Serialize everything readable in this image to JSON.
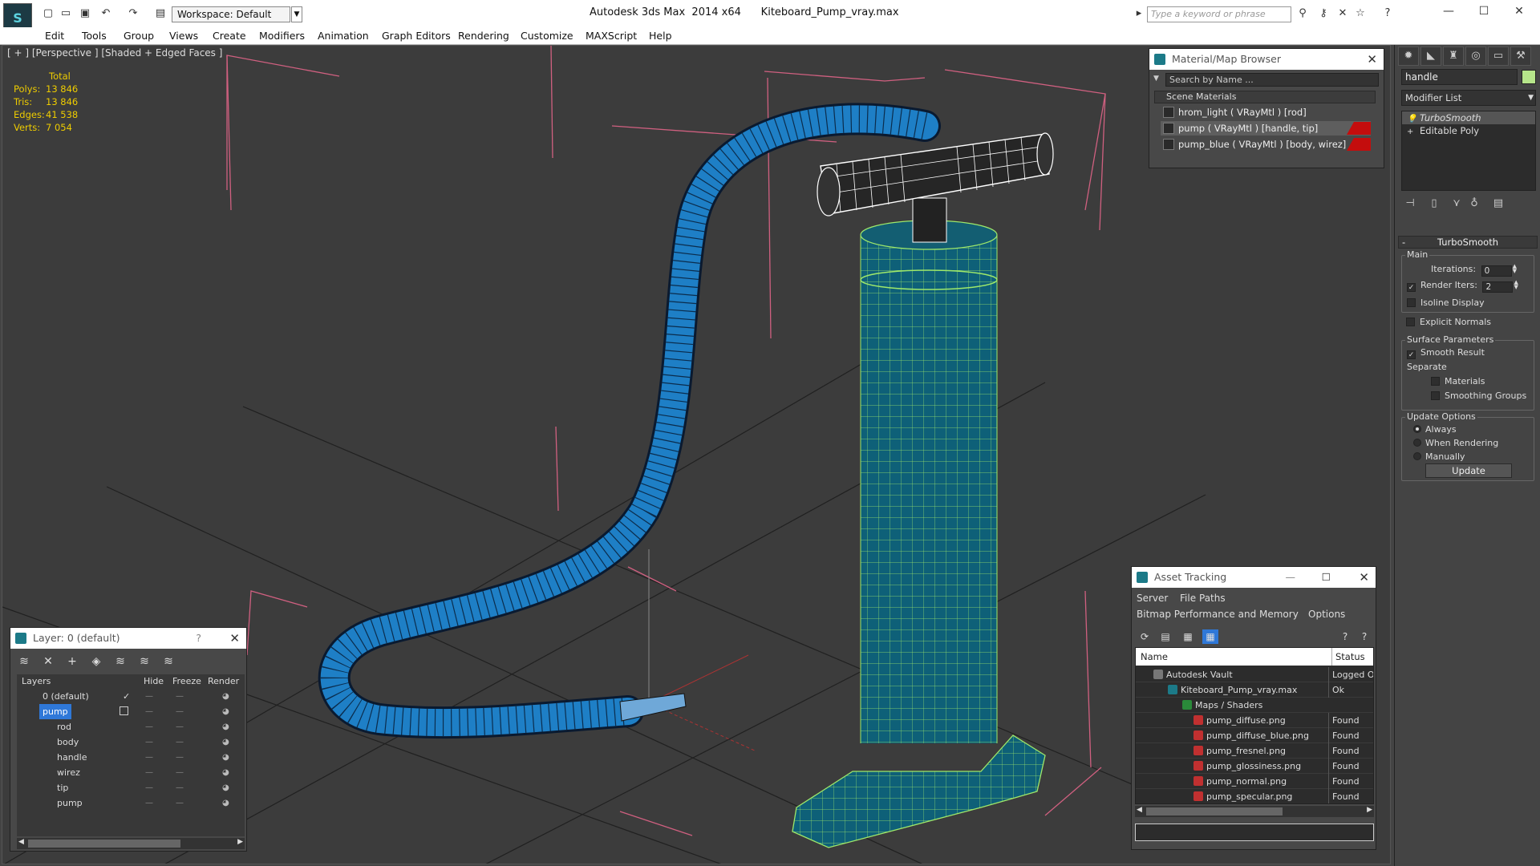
{
  "titlebar": {
    "workspace": "Workspace: Default",
    "app_title": "Autodesk 3ds Max  2014 x64      Kiteboard_Pump_vray.max",
    "search_placeholder": "Type a keyword or phrase"
  },
  "menu": [
    "Edit",
    "Tools",
    "Group",
    "Views",
    "Create",
    "Modifiers",
    "Animation",
    "Graph Editors",
    "Rendering",
    "Customize",
    "MAXScript",
    "Help"
  ],
  "viewport": {
    "label": "[ + ] [Perspective ] [Shaded + Edged Faces ]",
    "stats": {
      "header": "Total",
      "polys_label": "Polys:",
      "polys": "13 846",
      "tris_label": "Tris:",
      "tris": "13 846",
      "edges_label": "Edges:",
      "edges": "41 538",
      "verts_label": "Verts:",
      "verts": "7 054"
    }
  },
  "command_panel": {
    "object_name": "handle",
    "object_color": "#b6e58a",
    "modifier_list": "Modifier List",
    "stack": [
      "TurboSmooth",
      "Editable Poly"
    ],
    "rollout_title": "TurboSmooth",
    "main_group": "Main",
    "iterations_label": "Iterations:",
    "iterations": "0",
    "render_iters_label": "Render Iters:",
    "render_iters": "2",
    "isoline": "Isoline Display",
    "explicit_normals": "Explicit Normals",
    "surface_group": "Surface Parameters",
    "smooth_result": "Smooth Result",
    "separate": "Separate",
    "materials": "Materials",
    "smoothing_groups": "Smoothing Groups",
    "update_group": "Update Options",
    "always": "Always",
    "when_rendering": "When Rendering",
    "manually": "Manually",
    "update_button": "Update"
  },
  "material_browser": {
    "title": "Material/Map Browser",
    "search_placeholder": "Search by Name ...",
    "group": "Scene Materials",
    "materials": [
      "hrom_light  ( VRayMtl ) [rod]",
      "pump  ( VRayMtl ) [handle, tip]",
      "pump_blue  ( VRayMtl ) [body, wirez]"
    ]
  },
  "layer_dialog": {
    "title": "Layer: 0 (default)",
    "help": "?",
    "columns": [
      "Layers",
      "Hide",
      "Freeze",
      "Render"
    ],
    "rows": [
      {
        "name": "0 (default)",
        "indent": 1
      },
      {
        "name": "pump",
        "indent": 1
      },
      {
        "name": "rod",
        "indent": 2
      },
      {
        "name": "body",
        "indent": 2
      },
      {
        "name": "handle",
        "indent": 2
      },
      {
        "name": "wirez",
        "indent": 2
      },
      {
        "name": "tip",
        "indent": 2
      },
      {
        "name": "pump",
        "indent": 2
      }
    ]
  },
  "asset_tracking": {
    "title": "Asset Tracking",
    "menu1": [
      "Server",
      "File",
      "Paths"
    ],
    "menu2": [
      "Bitmap Performance and Memory",
      "Options"
    ],
    "columns": [
      "Name",
      "Status"
    ],
    "rows": [
      {
        "name": "Autodesk Vault",
        "status": "Logged Ou",
        "indent": 1
      },
      {
        "name": "Kiteboard_Pump_vray.max",
        "status": "Ok",
        "indent": 2
      },
      {
        "name": "Maps / Shaders",
        "status": "",
        "indent": 3
      },
      {
        "name": "pump_diffuse.png",
        "status": "Found",
        "indent": 4
      },
      {
        "name": "pump_diffuse_blue.png",
        "status": "Found",
        "indent": 4
      },
      {
        "name": "pump_fresnel.png",
        "status": "Found",
        "indent": 4
      },
      {
        "name": "pump_glossiness.png",
        "status": "Found",
        "indent": 4
      },
      {
        "name": "pump_normal.png",
        "status": "Found",
        "indent": 4
      },
      {
        "name": "pump_specular.png",
        "status": "Found",
        "indent": 4
      }
    ]
  }
}
